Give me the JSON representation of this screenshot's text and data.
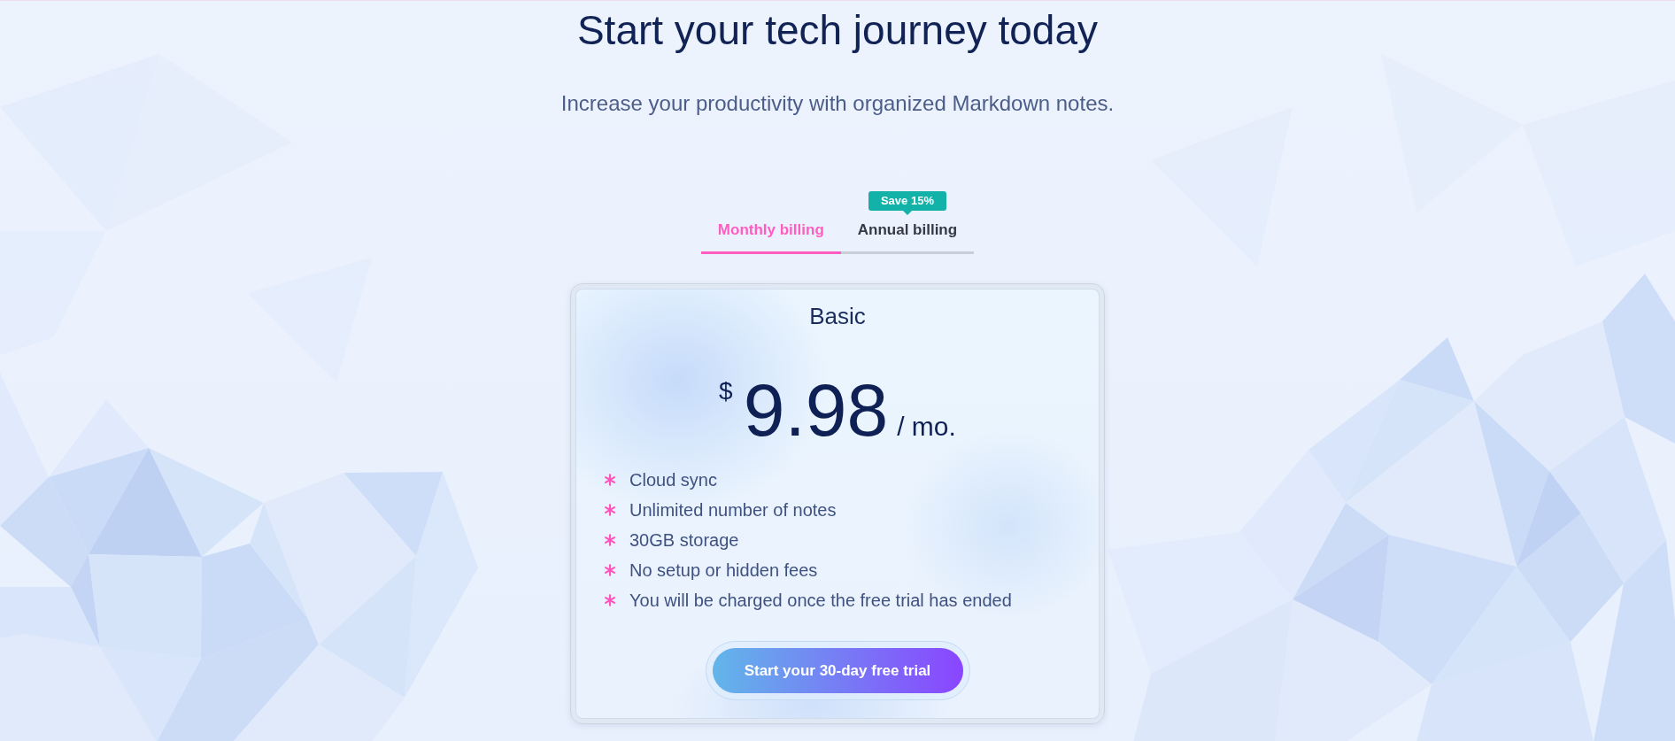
{
  "header": {
    "title": "Start your tech journey today",
    "subtitle": "Increase your productivity with organized Markdown notes."
  },
  "billing_tabs": [
    {
      "label": "Monthly billing",
      "selected": true
    },
    {
      "label": "Annual billing",
      "selected": false,
      "badge": "Save 15%"
    }
  ],
  "plan": {
    "name": "Basic",
    "currency": "$",
    "price": "9.98",
    "period": "/ mo.",
    "features": [
      "Cloud sync",
      "Unlimited number of notes",
      "30GB storage",
      "No setup or hidden fees",
      "You will be charged once the free trial has ended"
    ],
    "button": "Start your 30-day free trial"
  }
}
